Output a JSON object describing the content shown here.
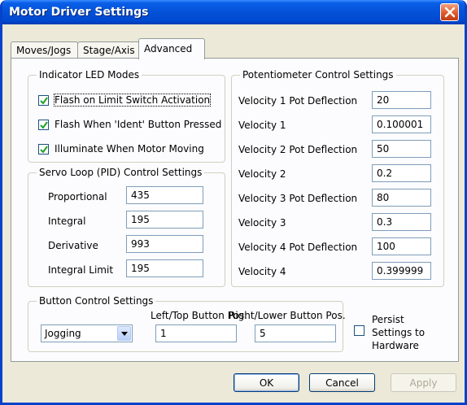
{
  "window": {
    "title": "Motor Driver Settings"
  },
  "tabs": [
    {
      "label": "Moves/Jogs",
      "active": false
    },
    {
      "label": "Stage/Axis",
      "active": false
    },
    {
      "label": "Advanced",
      "active": true
    }
  ],
  "led_modes": {
    "legend": "Indicator LED Modes",
    "items": [
      {
        "label": "Flash on Limit Switch Activation",
        "checked": true
      },
      {
        "label": "Flash When 'Ident' Button Pressed",
        "checked": true
      },
      {
        "label": "Illuminate When Motor Moving",
        "checked": true
      }
    ]
  },
  "pid": {
    "legend": "Servo Loop (PID) Control Settings",
    "fields": [
      {
        "label": "Proportional",
        "value": "435"
      },
      {
        "label": "Integral",
        "value": "195"
      },
      {
        "label": "Derivative",
        "value": "993"
      },
      {
        "label": "Integral Limit",
        "value": "195"
      }
    ]
  },
  "pot": {
    "legend": "Potentiometer Control Settings",
    "fields": [
      {
        "label": "Velocity 1 Pot Deflection",
        "value": "20"
      },
      {
        "label": "Velocity 1",
        "value": "0.100001"
      },
      {
        "label": "Velocity 2 Pot Deflection",
        "value": "50"
      },
      {
        "label": "Velocity 2",
        "value": "0.2"
      },
      {
        "label": "Velocity 3 Pot Deflection",
        "value": "80"
      },
      {
        "label": "Velocity 3",
        "value": "0.3"
      },
      {
        "label": "Velocity 4 Pot Deflection",
        "value": "100"
      },
      {
        "label": "Velocity 4",
        "value": "0.399999"
      }
    ]
  },
  "buttons_group": {
    "legend": "Button Control Settings",
    "mode_selected": "Jogging",
    "left_label": "Left/Top Button Pos.",
    "left_value": "1",
    "right_label": "Right/Lower Button Pos.",
    "right_value": "5"
  },
  "persist": {
    "label_line1": "Persist",
    "label_line2": "Settings to",
    "label_line3": "Hardware",
    "checked": false
  },
  "footer": {
    "ok": "OK",
    "cancel": "Cancel",
    "apply": "Apply"
  }
}
